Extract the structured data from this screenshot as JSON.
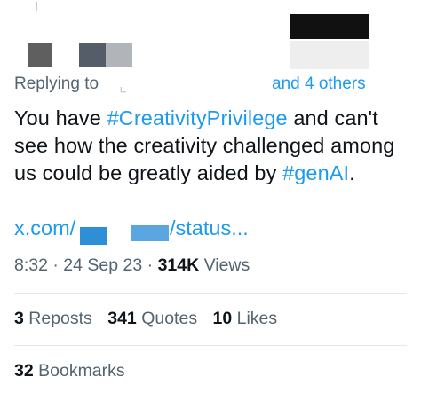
{
  "reply": {
    "label": "Replying to",
    "redacted_handle_mark": "ᴅ",
    "others": "and 4 others"
  },
  "tweet": {
    "segments": [
      {
        "text": "You have ",
        "hashtag": false
      },
      {
        "text": "#CreativityPrivilege",
        "hashtag": true
      },
      {
        "text": " and can't see how the creativity challenged among us could be greatly aided by ",
        "hashtag": false
      },
      {
        "text": "#genAI",
        "hashtag": true
      },
      {
        "text": ".",
        "hashtag": false
      }
    ]
  },
  "link": {
    "start": "x.com/",
    "end": "/status..."
  },
  "meta": {
    "time": "8:32",
    "sep1": " · ",
    "date": "24 Sep 23",
    "sep2": " · ",
    "views_count": "314K",
    "views_label": " Views"
  },
  "stats": {
    "reposts_count": "3",
    "reposts_label": " Reposts",
    "quotes_count": "341",
    "quotes_label": " Quotes",
    "likes_count": "10",
    "likes_label": " Likes"
  },
  "bookmarks": {
    "count": "32",
    "label": " Bookmarks"
  },
  "colors": {
    "accent": "#1d9bf0",
    "text": "#0f1419",
    "muted": "#536471",
    "divider": "#e6e9ec"
  }
}
